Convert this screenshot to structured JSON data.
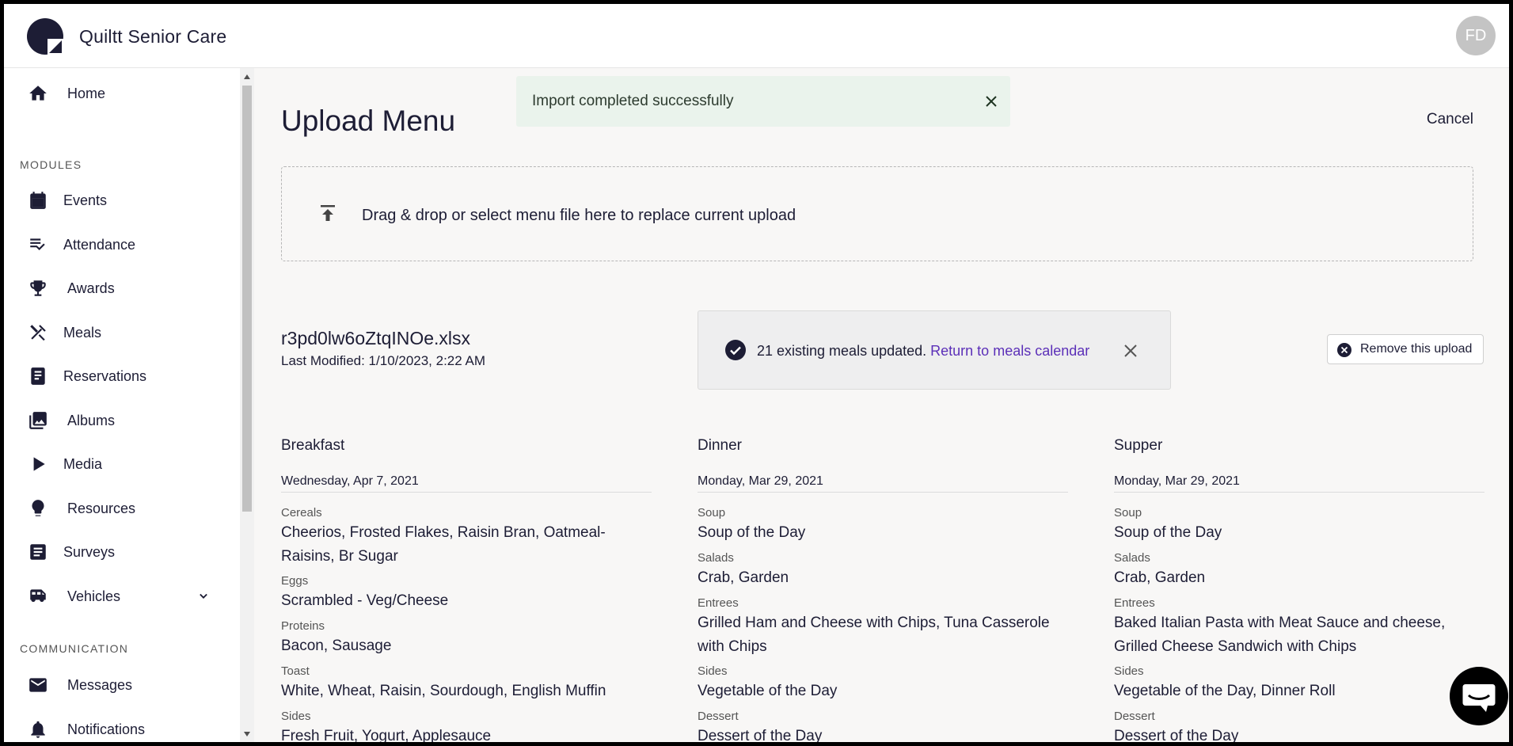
{
  "app": {
    "brand": "Quiltt Senior Care",
    "avatar_initials": "FD"
  },
  "sidebar": {
    "home": "Home",
    "modules_heading": "MODULES",
    "items": [
      {
        "label": "Events",
        "icon": "calendar-icon"
      },
      {
        "label": "Attendance",
        "icon": "checklist-icon"
      },
      {
        "label": "Awards",
        "icon": "trophy-icon"
      },
      {
        "label": "Meals",
        "icon": "utensils-icon"
      },
      {
        "label": "Reservations",
        "icon": "book-icon"
      },
      {
        "label": "Albums",
        "icon": "photo-library-icon"
      },
      {
        "label": "Media",
        "icon": "play-icon"
      },
      {
        "label": "Resources",
        "icon": "lightbulb-icon"
      },
      {
        "label": "Surveys",
        "icon": "survey-icon"
      },
      {
        "label": "Vehicles",
        "icon": "bus-icon"
      }
    ],
    "communication_heading": "COMMUNICATION",
    "comm_items": [
      {
        "label": "Messages",
        "icon": "mail-icon"
      },
      {
        "label": "Notifications",
        "icon": "bell-icon"
      }
    ]
  },
  "main": {
    "title": "Upload Menu",
    "cancel_label": "Cancel",
    "toast": "Import completed successfully",
    "dropzone_text": "Drag & drop or select menu file here to replace current upload",
    "file": {
      "name": "r3pd0lw6oZtqINOe.xlsx",
      "modified": "Last Modified: 1/10/2023, 2:22 AM"
    },
    "status": {
      "text": "21 existing meals updated.",
      "link": "Return to meals calendar"
    },
    "remove_label": "Remove this upload",
    "columns": [
      {
        "title": "Breakfast",
        "date": "Wednesday, Apr 7, 2021",
        "categories": [
          {
            "label": "Cereals",
            "items": "Cheerios, Frosted Flakes, Raisin Bran, Oatmeal-Raisins, Br Sugar"
          },
          {
            "label": "Eggs",
            "items": "Scrambled - Veg/Cheese"
          },
          {
            "label": "Proteins",
            "items": "Bacon, Sausage"
          },
          {
            "label": "Toast",
            "items": "White, Wheat, Raisin, Sourdough, English Muffin"
          },
          {
            "label": "Sides",
            "items": "Fresh Fruit, Yogurt, Applesauce"
          }
        ]
      },
      {
        "title": "Dinner",
        "date": "Monday, Mar 29, 2021",
        "categories": [
          {
            "label": "Soup",
            "items": "Soup of the Day"
          },
          {
            "label": "Salads",
            "items": "Crab, Garden"
          },
          {
            "label": "Entrees",
            "items": "Grilled Ham and Cheese with Chips, Tuna Casserole with Chips"
          },
          {
            "label": "Sides",
            "items": "Vegetable of the Day"
          },
          {
            "label": "Dessert",
            "items": "Dessert of the Day"
          }
        ]
      },
      {
        "title": "Supper",
        "date": "Monday, Mar 29, 2021",
        "categories": [
          {
            "label": "Soup",
            "items": "Soup of the Day"
          },
          {
            "label": "Salads",
            "items": "Crab, Garden"
          },
          {
            "label": "Entrees",
            "items": "Baked Italian Pasta with Meat Sauce and cheese, Grilled Cheese Sandwich with Chips"
          },
          {
            "label": "Sides",
            "items": "Vegetable of the Day, Dinner Roll"
          },
          {
            "label": "Dessert",
            "items": "Dessert of the Day"
          }
        ]
      }
    ]
  },
  "colors": {
    "accent": "#1d1d35",
    "link": "#5b2fb8",
    "toast_bg": "#eaf3ec"
  }
}
